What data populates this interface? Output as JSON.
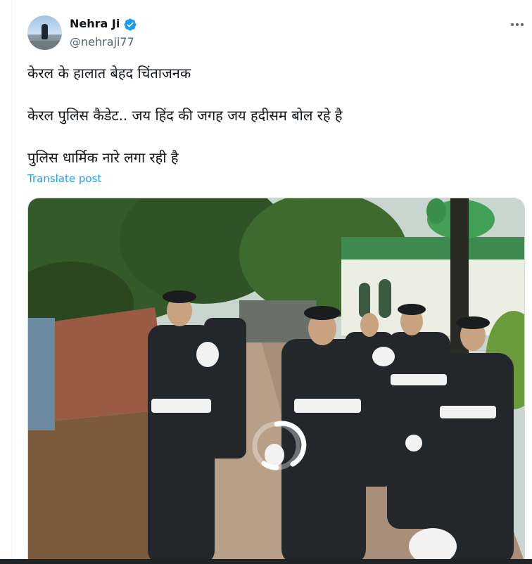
{
  "tweet": {
    "author": {
      "display_name": "Nehra Ji",
      "handle": "@nehraji77",
      "verified": true,
      "avatar_icon": "profile-photo"
    },
    "more_icon": "more-horizontal-icon",
    "text_lines": [
      "केरल के हालात बेहद चिंताजनक",
      "केरल पुलिस कैडेट.. जय हिंद की जगह जय हदीसम बोल रहे है",
      "पुलिस धार्मिक नारे लगा रही है"
    ],
    "translate_label": "Translate post",
    "media": {
      "type": "video",
      "state": "loading",
      "loading_icon": "loading-spinner-icon"
    }
  },
  "colors": {
    "link": "#1d9bf0",
    "verified": "#1d9bf0",
    "secondary_text": "#536471",
    "primary_text": "#0f1419"
  }
}
